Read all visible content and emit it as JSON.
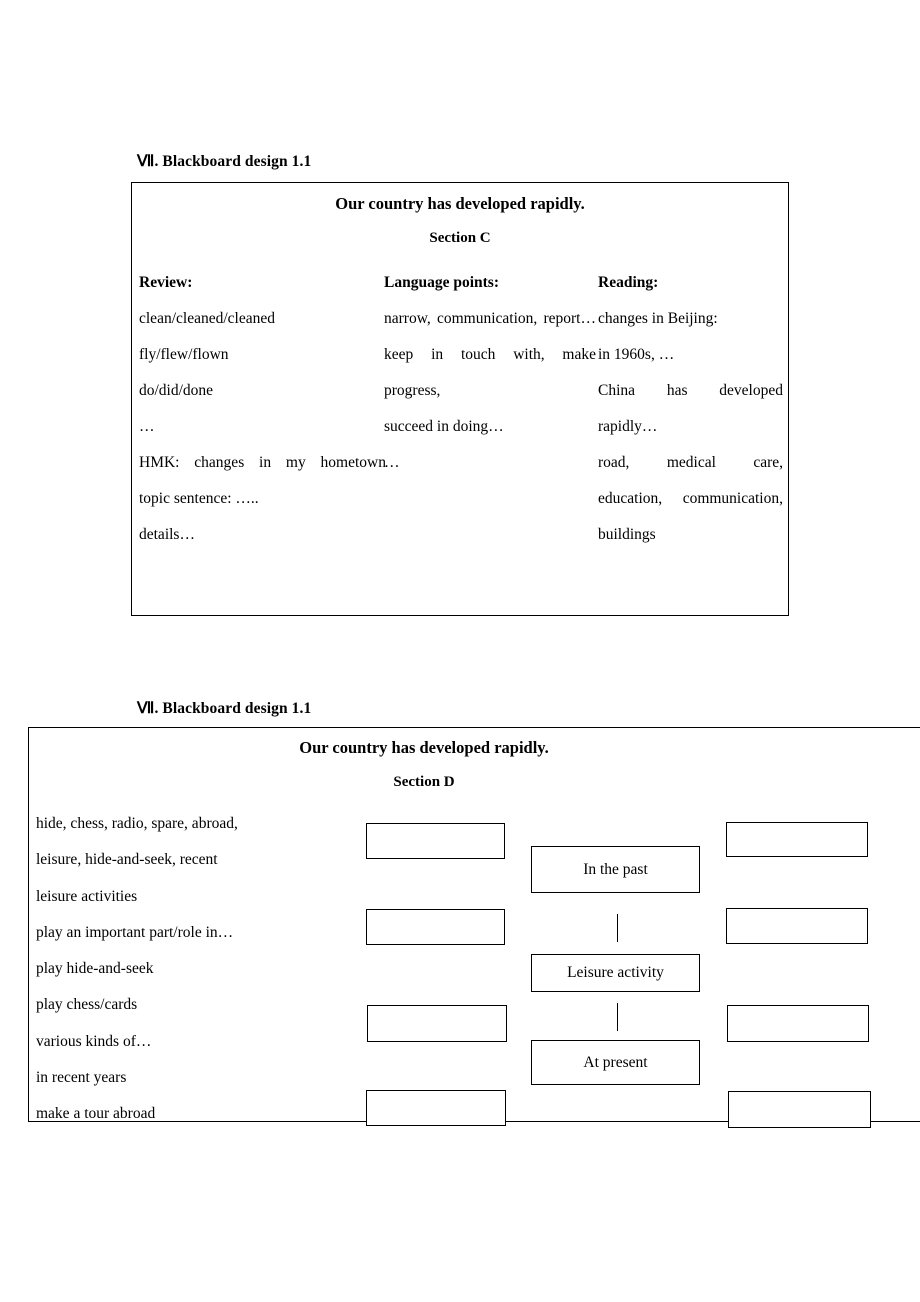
{
  "block1": {
    "heading": "Ⅶ. Blackboard design 1.1",
    "title": "Our country has developed rapidly.",
    "section": "Section C",
    "columns": [
      {
        "head": "Review:",
        "lines": [
          "clean/cleaned/cleaned",
          "fly/flew/flown",
          "do/did/done",
          "…",
          "HMK: changes in my hometown",
          "topic sentence: …..",
          "details…"
        ]
      },
      {
        "head": "Language points:",
        "lines": [
          "narrow, communication, report…",
          "keep in touch with, make progress,",
          "succeed in doing…",
          "…"
        ]
      },
      {
        "head": "Reading:",
        "lines": [
          "changes in Beijing:",
          "in 1960s, …",
          "China has developed rapidly…",
          "road, medical care, education, communication, buildings"
        ]
      }
    ]
  },
  "block2": {
    "heading": "Ⅶ. Blackboard design 1.1",
    "title": "Our country has developed rapidly.",
    "section": "Section D",
    "wordlist": [
      "hide, chess, radio, spare, abroad,",
      "leisure, hide-and-seek, recent",
      "leisure activities",
      "play an important part/role in…",
      "play hide-and-seek",
      "play chess/cards",
      "various kinds of…",
      "in recent years",
      "make a tour abroad"
    ],
    "center_boxes": [
      {
        "label": "In the past"
      },
      {
        "label": "Leisure activity"
      },
      {
        "label": "At present"
      }
    ],
    "empty_boxes_left": [
      "",
      "",
      "",
      ""
    ],
    "empty_boxes_right": [
      "",
      "",
      "",
      ""
    ]
  }
}
